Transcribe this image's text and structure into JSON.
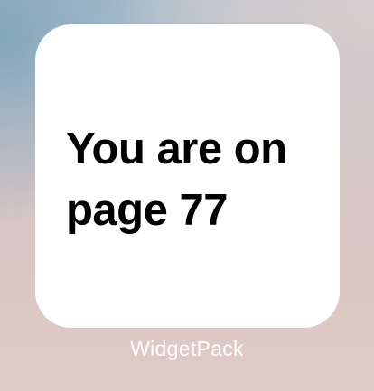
{
  "widget": {
    "message": "You are on page 77",
    "background_color": "#ffffff",
    "text_color": "#000000"
  },
  "app_label": "WidgetPack",
  "wallpaper": {
    "colors": [
      "#7aa0b9",
      "#c6c9cf",
      "#d4c6c5",
      "#e0cac6"
    ]
  }
}
